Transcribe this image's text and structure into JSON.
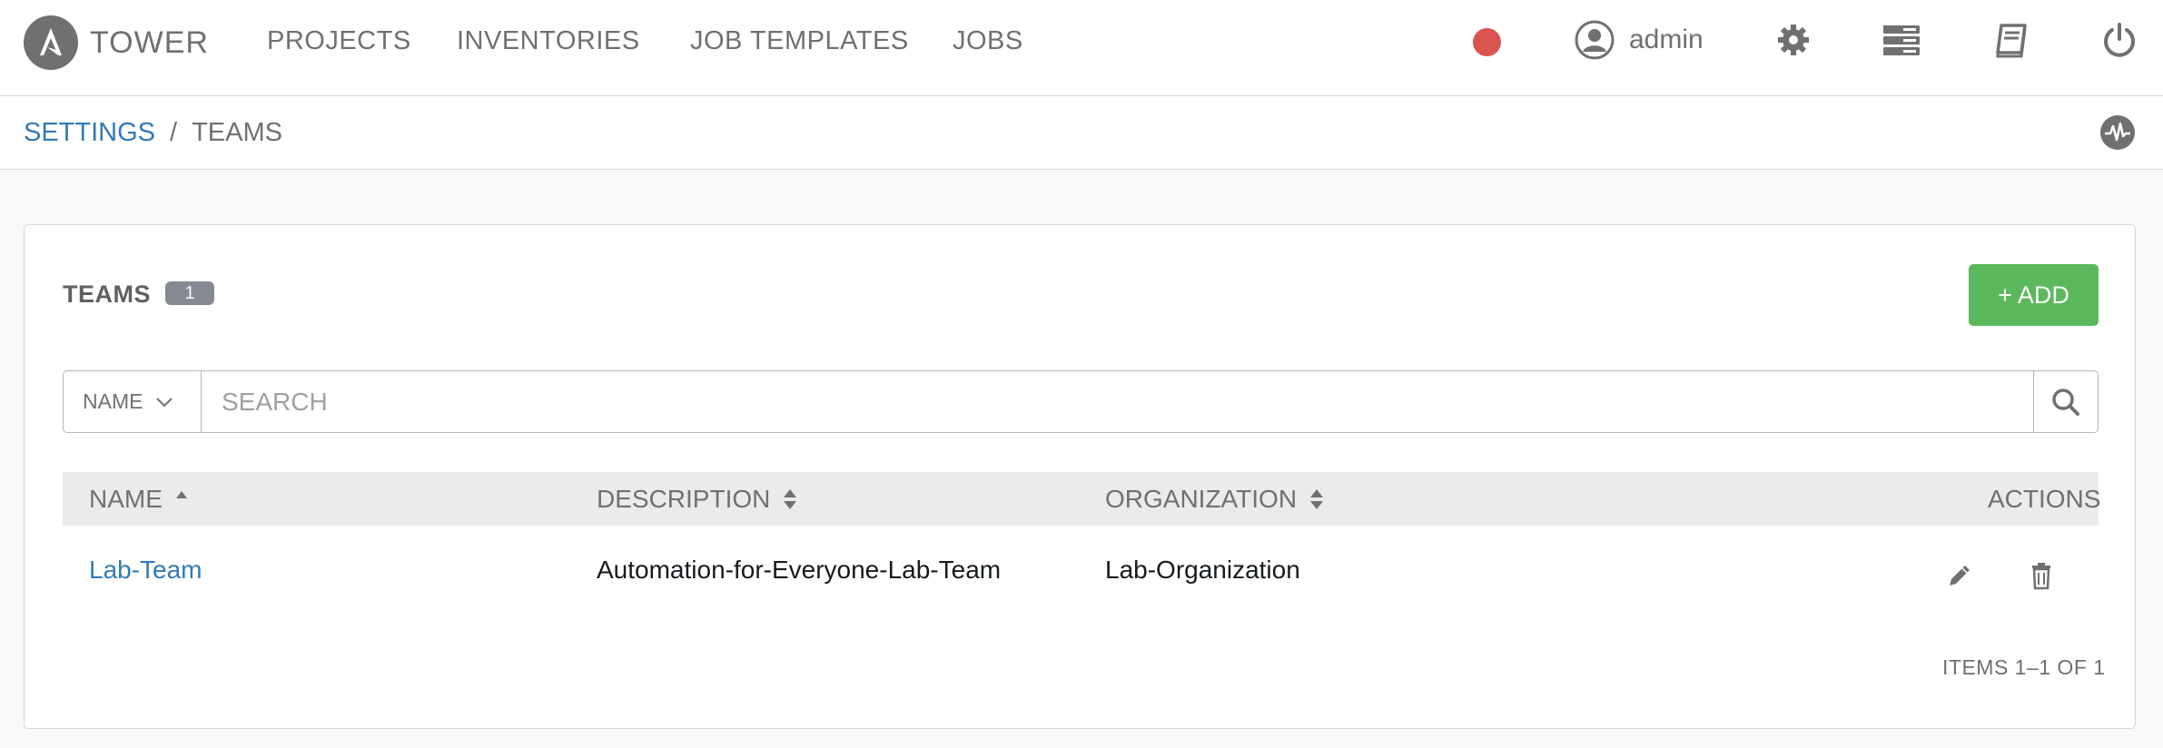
{
  "app": {
    "brand": "TOWER"
  },
  "nav": {
    "items": [
      {
        "label": "PROJECTS"
      },
      {
        "label": "INVENTORIES"
      },
      {
        "label": "JOB TEMPLATES"
      },
      {
        "label": "JOBS"
      }
    ]
  },
  "user": {
    "name": "admin"
  },
  "icons": {
    "status": "status-dot-icon",
    "user": "user-circle-icon",
    "settings": "gear-icon",
    "server": "server-icon",
    "docs": "book-icon",
    "logout": "power-icon",
    "activity": "activity-stream-icon",
    "search": "search-icon",
    "edit": "pencil-icon",
    "delete": "trash-icon"
  },
  "colors": {
    "accent": "#337ab7",
    "add": "#5cb85c",
    "status": "#d9534f",
    "badge": "#848992"
  },
  "breadcrumb": {
    "parent": "SETTINGS",
    "separator": "/",
    "current": "TEAMS"
  },
  "panel": {
    "title": "TEAMS",
    "count": "1",
    "add_label": "+ ADD"
  },
  "search": {
    "field": "NAME",
    "placeholder": "SEARCH",
    "value": ""
  },
  "table": {
    "columns": [
      {
        "label": "NAME",
        "sort": "ascending"
      },
      {
        "label": "DESCRIPTION",
        "sort": "sortable"
      },
      {
        "label": "ORGANIZATION",
        "sort": "sortable"
      },
      {
        "label": "ACTIONS",
        "sort": "none"
      }
    ],
    "rows": [
      {
        "name": "Lab-Team",
        "description": "Automation-for-Everyone-Lab-Team",
        "organization": "Lab-Organization"
      }
    ]
  },
  "pagination": {
    "label": "ITEMS 1–1 OF 1"
  }
}
